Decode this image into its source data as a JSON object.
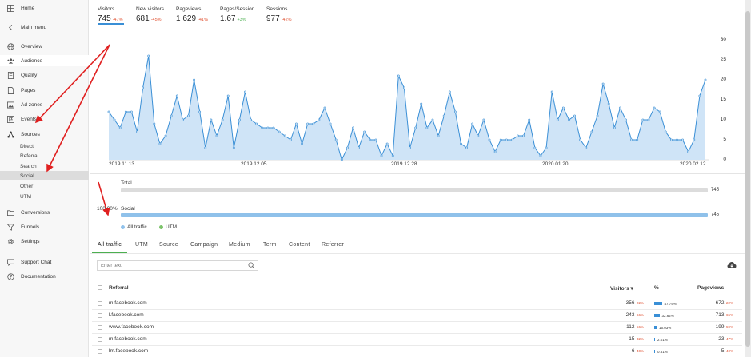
{
  "sidebar": {
    "home": "Home",
    "main_menu": "Main menu",
    "items": [
      {
        "label": "Overview",
        "icon": "globe-icon"
      },
      {
        "label": "Audience",
        "icon": "users-icon"
      },
      {
        "label": "Quality",
        "icon": "list-icon"
      },
      {
        "label": "Pages",
        "icon": "document-icon"
      },
      {
        "label": "Ad zones",
        "icon": "image-icon"
      },
      {
        "label": "Events",
        "icon": "flag-icon"
      },
      {
        "label": "Sources",
        "icon": "share-icon"
      }
    ],
    "sources_sub": [
      "Direct",
      "Referral",
      "Search",
      "Social",
      "Other",
      "UTM"
    ],
    "items2": [
      {
        "label": "Conversions",
        "icon": "folder-icon"
      },
      {
        "label": "Funnels",
        "icon": "funnel-icon"
      },
      {
        "label": "Settings",
        "icon": "gear-icon"
      }
    ],
    "items3": [
      {
        "label": "Support Chat",
        "icon": "chat-icon"
      },
      {
        "label": "Documentation",
        "icon": "help-icon"
      }
    ]
  },
  "metrics": [
    {
      "label": "Visitors",
      "value": "745",
      "change": "-47%",
      "dir": "neg"
    },
    {
      "label": "New visitors",
      "value": "681",
      "change": "-45%",
      "dir": "neg"
    },
    {
      "label": "Pageviews",
      "value": "1 629",
      "change": "-41%",
      "dir": "neg"
    },
    {
      "label": "Pages/Session",
      "value": "1.67",
      "change": "+3%",
      "dir": "pos"
    },
    {
      "label": "Sessions",
      "value": "977",
      "change": "-42%",
      "dir": "neg"
    }
  ],
  "chart_data": {
    "type": "area",
    "x_ticks": [
      "2019.11.13",
      "2019.12.05",
      "2019.12.28",
      "2020.01.20",
      "2020.02.12"
    ],
    "y_ticks": [
      "30",
      "25",
      "20",
      "15",
      "10",
      "5",
      "0"
    ],
    "ylim": [
      0,
      30
    ],
    "values": [
      12,
      10,
      8,
      12,
      12,
      7,
      18,
      26,
      9,
      4,
      6,
      11,
      16,
      10,
      11,
      20,
      12,
      3,
      10,
      6,
      10,
      16,
      3,
      10,
      17,
      10,
      9,
      8,
      8,
      8,
      7,
      6,
      5,
      9,
      4,
      9,
      9,
      10,
      13,
      9,
      5,
      0,
      3,
      8,
      3,
      7,
      5,
      5,
      1,
      4,
      1,
      21,
      18,
      3,
      8,
      14,
      8,
      10,
      6,
      11,
      17,
      12,
      4,
      3,
      9,
      6,
      10,
      5,
      2,
      5,
      5,
      5,
      6,
      6,
      10,
      3,
      1,
      3,
      17,
      10,
      13,
      10,
      11,
      5,
      3,
      7,
      11,
      19,
      14,
      8,
      13,
      10,
      5,
      5,
      10,
      10,
      13,
      12,
      7,
      5,
      5,
      5,
      2,
      5,
      16,
      20
    ],
    "color": "#3a8fd6",
    "fill": "#cfe4f7"
  },
  "totals": {
    "total_label": "Total",
    "total_value": "745",
    "pct_label": "100.00%",
    "social_label": "Social",
    "social_value": "745"
  },
  "legend": [
    {
      "label": "All traffic",
      "color": "#90c2ec"
    },
    {
      "label": "UTM",
      "color": "#7cc36a"
    }
  ],
  "filter_tabs": [
    "All traffic",
    "UTM",
    "Source",
    "Campaign",
    "Medium",
    "Term",
    "Content",
    "Referrer"
  ],
  "search": {
    "placeholder": "Enter text"
  },
  "table": {
    "headers": {
      "referral": "Referral",
      "visitors": "Visitors",
      "sort": "▾",
      "pct": "%",
      "pageviews": "Pageviews"
    },
    "rows": [
      {
        "name": "m.facebook.com",
        "visitors": "356",
        "vchg": "-22%",
        "pct": "47.79%",
        "pct_val": 47.79,
        "pageviews": "672",
        "pchg": "-22%"
      },
      {
        "name": "l.facebook.com",
        "visitors": "243",
        "vchg": "-66%",
        "pct": "32.62%",
        "pct_val": 32.62,
        "pageviews": "713",
        "pchg": "-65%"
      },
      {
        "name": "www.facebook.com",
        "visitors": "112",
        "vchg": "-56%",
        "pct": "15.03%",
        "pct_val": 15.03,
        "pageviews": "199",
        "pchg": "-59%"
      },
      {
        "name": "m.facebook.com",
        "visitors": "15",
        "vchg": "-32%",
        "pct": "2.01%",
        "pct_val": 2.01,
        "pageviews": "23",
        "pchg": "-47%"
      },
      {
        "name": "lm.facebook.com",
        "visitors": "6",
        "vchg": "-40%",
        "pct": "0.81%",
        "pct_val": 0.81,
        "pageviews": "5",
        "pchg": "-40%"
      }
    ]
  }
}
